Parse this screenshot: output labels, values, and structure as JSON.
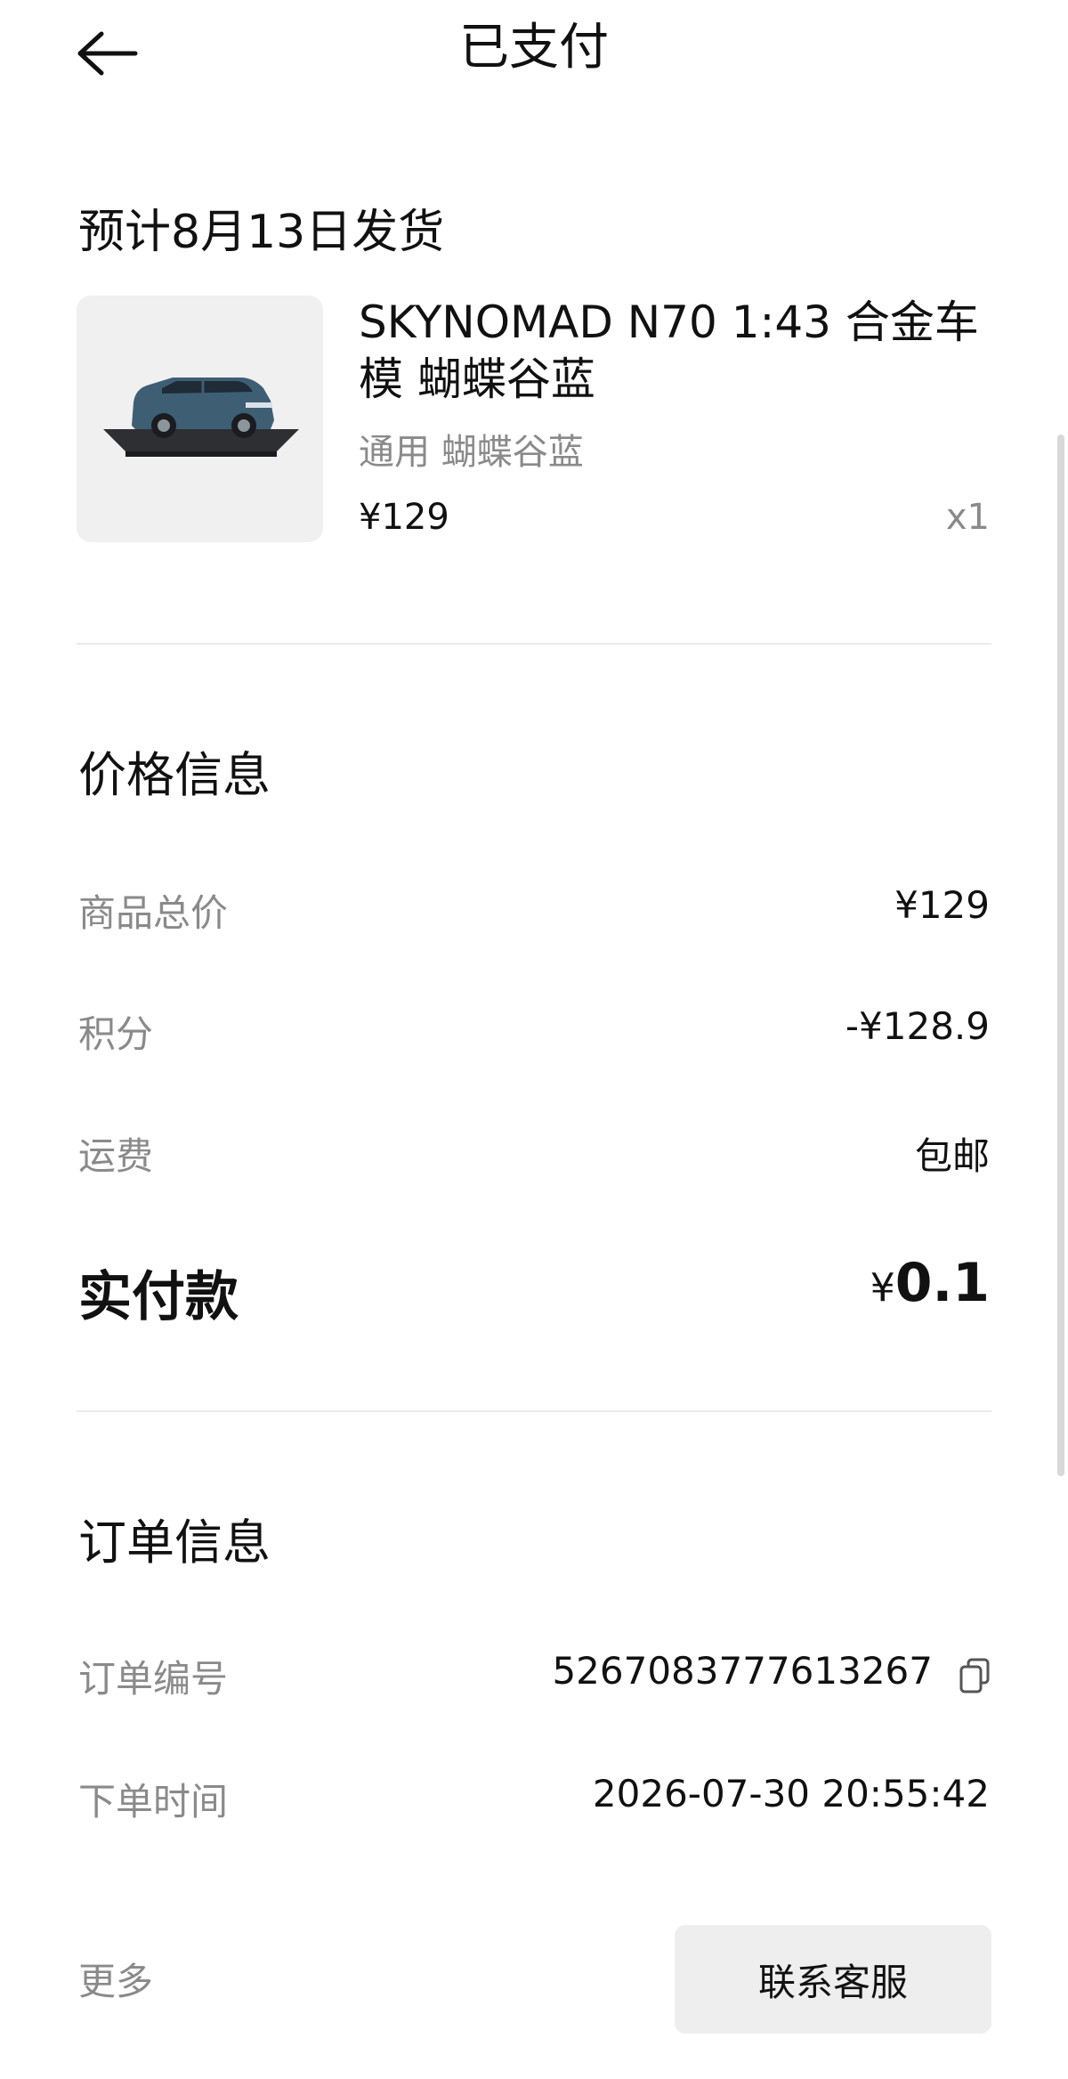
{
  "header": {
    "title": "已支付"
  },
  "shipping": {
    "text": "预计8月13日发货"
  },
  "product": {
    "name": "SKYNOMAD N70 1:43 合金车模 蝴蝶谷蓝",
    "spec": "通用 蝴蝶谷蓝",
    "price": "¥129",
    "qty": "x1"
  },
  "price_info": {
    "title": "价格信息",
    "rows": [
      {
        "label": "商品总价",
        "value": "¥129"
      },
      {
        "label": "积分",
        "value": "-¥128.9"
      },
      {
        "label": "运费",
        "value": "包邮"
      }
    ],
    "total_label": "实付款",
    "total_currency": "¥",
    "total_amount": "0.1"
  },
  "order_info": {
    "title": "订单信息",
    "rows": [
      {
        "label": "订单编号",
        "value": "5267083777613267"
      },
      {
        "label": "下单时间",
        "value": "2026-07-30 20:55:42"
      }
    ]
  },
  "footer": {
    "more": "更多",
    "contact_button": "联系客服"
  },
  "colors": {
    "muted_text": "#8a8a8a",
    "button_bg": "#eeeeee",
    "divider": "#ebebeb"
  },
  "icons": [
    "back-arrow-icon",
    "copy-icon"
  ]
}
